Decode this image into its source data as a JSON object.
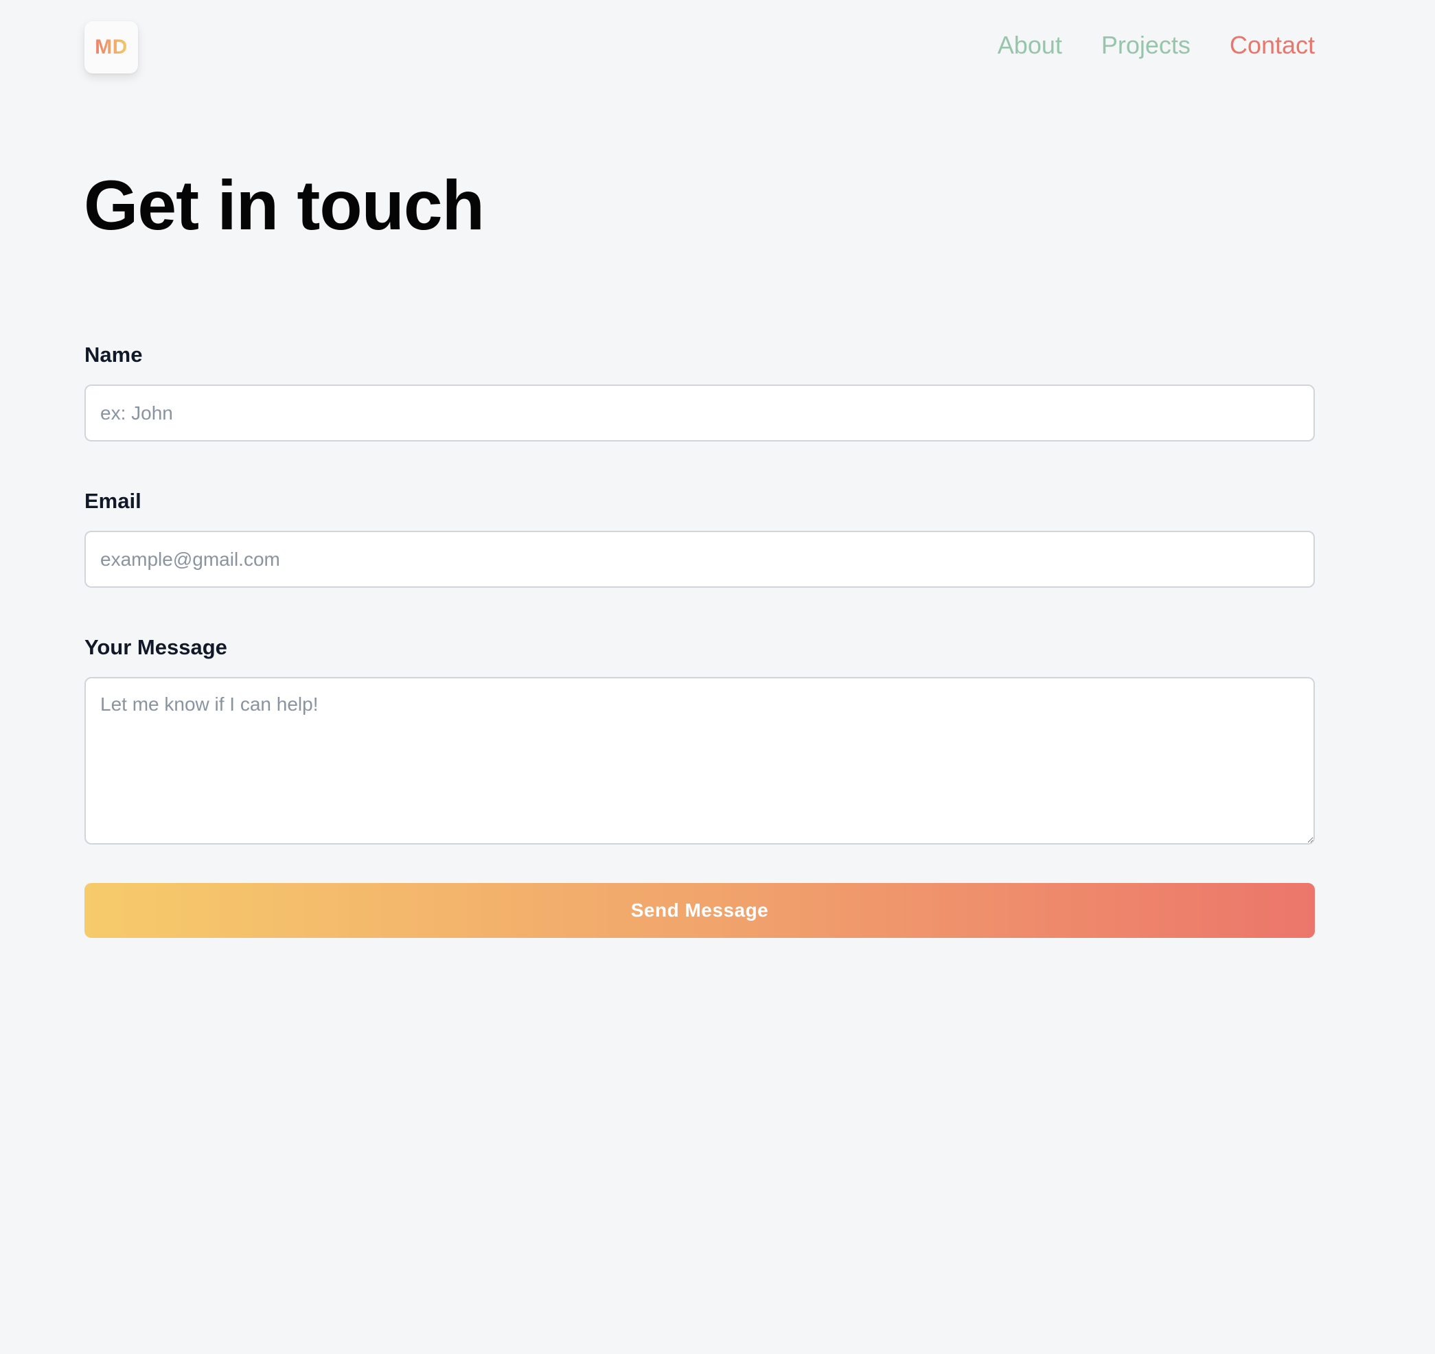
{
  "header": {
    "logo_text": "MD",
    "nav": [
      {
        "label": "About"
      },
      {
        "label": "Projects"
      },
      {
        "label": "Contact"
      }
    ]
  },
  "main": {
    "title": "Get in touch",
    "form": {
      "name_label": "Name",
      "name_placeholder": "ex: John",
      "email_label": "Email",
      "email_placeholder": "example@gmail.com",
      "message_label": "Your Message",
      "message_placeholder": "Let me know if I can help!",
      "submit_label": "Send Message"
    }
  },
  "colors": {
    "background": "#f5f6f8",
    "nav_muted": "#97c5ab",
    "nav_active": "#e8766b",
    "gradient_start": "#f6cb6b",
    "gradient_end": "#ec766b"
  }
}
